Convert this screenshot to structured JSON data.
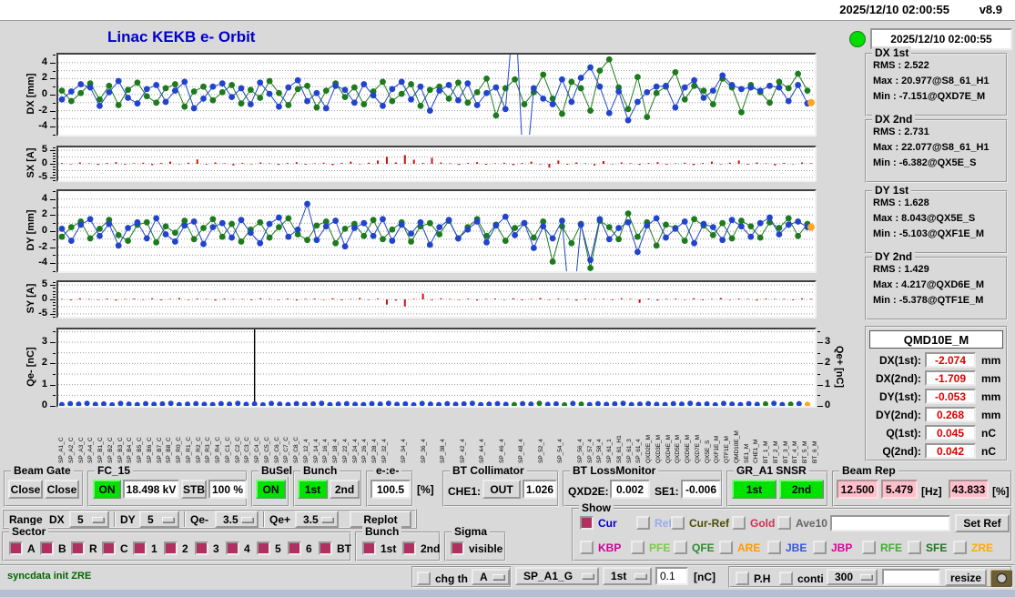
{
  "topbar": {
    "datetime": "2025/12/10 02:00:55",
    "version": "v8.9"
  },
  "title": "Linac KEKB e- Orbit",
  "status": {
    "datetime": "2025/12/10 02:00:55"
  },
  "stats_groups": [
    {
      "legend": "DX 1st",
      "lines": [
        "RMS :  2.522",
        "Max :  20.977@S8_61_H1",
        "Min :  -7.151@QXD7E_M"
      ]
    },
    {
      "legend": "DX 2nd",
      "lines": [
        "RMS :  2.731",
        "Max :  22.077@S8_61_H1",
        "Min :  -6.382@QX5E_S"
      ]
    },
    {
      "legend": "DY 1st",
      "lines": [
        "RMS :  1.628",
        "Max :  8.043@QX5E_S",
        "Min :  -5.103@QXF1E_M"
      ]
    },
    {
      "legend": "DY 2nd",
      "lines": [
        "RMS :  1.429",
        "Max :  4.217@QXD6E_M",
        "Min :  -5.378@QTF1E_M"
      ]
    }
  ],
  "qmd": {
    "title": "QMD10E_M",
    "rows": [
      {
        "label": "DX(1st):",
        "value": "-2.074",
        "unit": "mm"
      },
      {
        "label": "DX(2nd):",
        "value": "-1.709",
        "unit": "mm"
      },
      {
        "label": "DY(1st):",
        "value": "-0.053",
        "unit": "mm"
      },
      {
        "label": "DY(2nd):",
        "value": "0.268",
        "unit": "mm"
      },
      {
        "label": "Q(1st):",
        "value": "0.045",
        "unit": "nC"
      },
      {
        "label": "Q(2nd):",
        "value": "0.042",
        "unit": "nC"
      }
    ]
  },
  "axes": {
    "dx": {
      "label": "DX [mm]",
      "ticks": [
        4,
        2,
        0,
        -2,
        -4
      ],
      "ylim": [
        -5,
        5
      ],
      "minor": 1
    },
    "sx": {
      "label": "SX [A]",
      "ticks": [
        5,
        0,
        -5
      ],
      "ylim": [
        -6,
        6
      ],
      "minor": 1
    },
    "dy": {
      "label": "DY [mm]",
      "ticks": [
        4,
        2,
        0,
        -2,
        -4
      ],
      "ylim": [
        -5,
        5
      ],
      "minor": 1
    },
    "sy": {
      "label": "SY [A]",
      "ticks": [
        5,
        0,
        -5
      ],
      "ylim": [
        -6,
        6
      ],
      "minor": 1
    },
    "q": {
      "label_left": "Qe- [nC]",
      "label_right": "Qe+ [nC]",
      "ticks": [
        3,
        2,
        1,
        0
      ],
      "ylim": [
        0,
        3.6
      ],
      "minor": 0.5
    }
  },
  "chart_data": {
    "dx_orbit": {
      "type": "line",
      "title": "DX [mm]",
      "ylim": [
        -5,
        5
      ],
      "grid_step": 1,
      "series": [
        {
          "name": "DX 2nd",
          "color": "#1d7a1d",
          "values": [
            0.5,
            -0.8,
            0.2,
            1.4,
            -0.6,
            1.1,
            -1.3,
            0.6,
            1.5,
            -0.2,
            -1.0,
            0.8,
            1.3,
            -1.5,
            0.4,
            1.0,
            -0.7,
            0.3,
            1.2,
            -1.1,
            0.6,
            -0.4,
            1.7,
            0.2,
            -1.3,
            0.7,
            1.1,
            -1.6,
            0.5,
            1.4,
            -0.3,
            0.9,
            -1.2,
            0.4,
            1.6,
            -0.8,
            0.1,
            1.3,
            -1.4,
            0.6,
            1.0,
            -0.5,
            1.5,
            -1.0,
            0.3,
            2.0,
            -2.6,
            0.8,
            1.9,
            -1.2,
            0.3,
            2.5,
            -0.5,
            -2.4,
            1.6,
            0.8,
            -2.0,
            3.0,
            4.4,
            0.9,
            -1.8,
            2.2,
            -2.8,
            0.2,
            1.0,
            2.8,
            -0.6,
            1.1,
            0.5,
            -1.2,
            2.0,
            0.9,
            -2.2,
            1.2,
            0.3,
            -1.0,
            1.6,
            0.8,
            2.6,
            0.5
          ]
        },
        {
          "name": "DX 1st",
          "color": "#2244cc",
          "values": [
            -0.6,
            0.4,
            1.3,
            0.9,
            -1.4,
            0.3,
            1.7,
            -0.4,
            -1.1,
            0.7,
            1.2,
            -0.9,
            0.5,
            1.6,
            -1.7,
            -0.5,
            1.0,
            1.4,
            -0.3,
            0.8,
            -1.2,
            1.5,
            0.1,
            -1.5,
            0.9,
            1.8,
            -0.8,
            0.2,
            -1.7,
            1.1,
            0.6,
            -1.0,
            1.3,
            -0.1,
            -1.4,
            0.7,
            1.6,
            -0.6,
            1.0,
            -2.0,
            0.5,
            1.2,
            -0.7,
            1.4,
            -1.3,
            0.2,
            0.9,
            -1.8,
            12.0,
            -12.0,
            0.8,
            -0.5,
            -1.2,
            1.9,
            -0.9,
            2.1,
            3.4,
            1.0,
            -2.3,
            0.4,
            -3.2,
            -0.9,
            0.3,
            1.0,
            1.1,
            -1.6,
            0.9,
            1.8,
            -0.4,
            0.5,
            2.4,
            1.2,
            0.7,
            0.9,
            0.5,
            1.1,
            0.9,
            -0.8,
            1.2,
            -1.1
          ]
        }
      ],
      "extra_point": {
        "color": "#ffa520",
        "value": -1.0
      }
    },
    "sx_steering": {
      "type": "bar",
      "title": "SX [A]",
      "ylim": [
        -6,
        6
      ],
      "color": "#cc1111",
      "count": 84,
      "values_cycle": [
        0.3,
        -0.2,
        0.5,
        0.2,
        -0.4,
        0.3,
        0.6,
        -0.3,
        0.2,
        0.4,
        -0.5,
        0.3,
        0.8,
        -0.2,
        0.4,
        1.2,
        -0.3,
        0.5,
        0.2,
        -0.6
      ],
      "overrides": {
        "15": 1.6,
        "36": 2.6,
        "38": 3.2,
        "39": 1.5,
        "41": 2.2,
        "54": -1.4,
        "60": 1.0
      }
    },
    "dy_orbit": {
      "type": "line",
      "title": "DY [mm]",
      "ylim": [
        -5,
        5
      ],
      "grid_step": 1,
      "series": [
        {
          "name": "DY 2nd",
          "color": "#1d7a1d",
          "values": [
            -0.7,
            0.5,
            1.2,
            -0.9,
            0.3,
            1.4,
            -0.5,
            -1.2,
            0.8,
            1.1,
            -1.4,
            0.6,
            -0.2,
            1.3,
            -1.0,
            0.4,
            1.5,
            -0.7,
            0.9,
            -1.3,
            0.2,
            1.1,
            -0.8,
            0.5,
            1.6,
            -0.4,
            -1.1,
            0.7,
            1.2,
            -1.5,
            0.3,
            0.9,
            -0.6,
            1.4,
            -1.0,
            0.2,
            1.1,
            -1.3,
            0.6,
            1.0,
            -0.4,
            1.3,
            -0.9,
            0.5,
            1.5,
            -0.6,
            0.8,
            -1.2,
            0.4,
            1.0,
            -0.8,
            1.2,
            -3.8,
            0.6,
            -1.5,
            0.9,
            -4.6,
            1.3,
            0.5,
            -1.0,
            2.2,
            -0.7,
            1.1,
            -1.8,
            0.8,
            0.4,
            -1.2,
            1.5,
            0.7,
            -0.5,
            1.0,
            -0.9,
            1.3,
            0.6,
            -0.8,
            1.1,
            0.4,
            1.6,
            -0.6,
            0.9
          ]
        },
        {
          "name": "DY 1st",
          "color": "#2244cc",
          "values": [
            0.3,
            -1.2,
            0.8,
            1.5,
            -0.6,
            0.9,
            -1.8,
            0.4,
            1.1,
            -0.9,
            1.6,
            -0.4,
            -1.3,
            0.7,
            1.2,
            -1.6,
            0.5,
            1.0,
            -0.8,
            1.4,
            -0.2,
            -1.5,
            0.9,
            1.7,
            -0.7,
            0.2,
            3.4,
            -1.1,
            0.6,
            1.3,
            -1.9,
            0.4,
            1.0,
            -0.6,
            1.5,
            -1.2,
            0.8,
            -0.3,
            1.1,
            -1.7,
            0.5,
            1.4,
            -0.9,
            0.2,
            1.2,
            -1.4,
            0.7,
            1.8,
            -0.5,
            1.0,
            -2.1,
            0.6,
            -0.9,
            1.3,
            -12.0,
            0.8,
            -3.6,
            1.5,
            -1.0,
            0.4,
            1.1,
            -2.6,
            0.7,
            1.6,
            -0.8,
            0.3,
            1.2,
            -1.5,
            0.9,
            0.5,
            -1.1,
            1.4,
            0.6,
            -0.7,
            1.0,
            1.7,
            -0.4,
            0.8,
            1.2,
            0.5
          ]
        }
      ],
      "extra_point": {
        "color": "#ffa520",
        "value": 0.5
      }
    },
    "sy_steering": {
      "type": "bar",
      "title": "SY [A]",
      "ylim": [
        -6,
        6
      ],
      "color": "#cc1111",
      "count": 84,
      "values_cycle": [
        0.2,
        -0.3,
        0.4,
        0.2,
        -0.2,
        0.3,
        -0.4,
        0.2,
        0.3,
        -0.2,
        0.4,
        -0.3,
        0.2,
        0.5,
        -0.2,
        0.3,
        0.2,
        -0.4,
        0.3,
        0.2
      ],
      "overrides": {
        "36": -1.8,
        "38": -2.4,
        "40": 2.0,
        "64": -1.2
      }
    },
    "charge": {
      "type": "scatter",
      "title": "Qe- [nC]",
      "right_axis": "Qe+ [nC]",
      "ylim": [
        0,
        3.6
      ],
      "dot_color": "#2244cc",
      "green_color": "#1d7a1d",
      "last_color": "#ffa520",
      "count": 90,
      "values_cycle": [
        0.06,
        0.1,
        0.08,
        0.12,
        0.07,
        0.09,
        0.05,
        0.11,
        0.08,
        0.06,
        0.1,
        0.07,
        0.09,
        0.12,
        0.06,
        0.08,
        0.1,
        0.07
      ],
      "spike_index": 23,
      "green_indices": [
        54,
        57,
        60,
        62,
        84,
        87
      ]
    }
  },
  "xaxis_labels": [
    "SP_A1_C",
    "SP_A2_C",
    "SP_A3_C",
    "SP_A4_C",
    "SP_B1_C",
    "SP_B2_C",
    "SP_B3_C",
    "SP_B4_C",
    "SP_B5_C",
    "SP_B6_C",
    "SP_B7_C",
    "SP_B8_C",
    "SP_R0_C",
    "SP_R1_C",
    "SP_R2_C",
    "SP_R3_C",
    "SP_R4_C",
    "SP_C1_C",
    "SP_C2_C",
    "SP_C3_C",
    "SP_C4_C",
    "SP_C5_C",
    "SP_C6_C",
    "SP_C7_C",
    "SP_C8_C",
    "SP_12_4",
    "SP_14_4",
    "SP_16_4",
    "SP_18_4",
    "SP_22_4",
    "SP_24_4",
    "SP_26_4",
    "SP_28_4",
    "SP_32_4",
    "",
    "SP_34_4",
    "",
    "SP_36_4",
    "",
    "SP_38_4",
    "",
    "SP_42_4",
    "",
    "SP_44_4",
    "",
    "SP_46_4",
    "",
    "SP_48_4",
    "",
    "SP_52_4",
    "",
    "SP_54_4",
    "",
    "SP_56_4",
    "SP_57_4",
    "SP_58_4",
    "SP_61_1",
    "S8_61_H1",
    "SP_61_3",
    "SP_61_4",
    "QXD2E_M",
    "QXD3E_M",
    "QXD4E_M",
    "QXD5E_M",
    "QXD6E_M",
    "QXD7E_M",
    "QX5E_S",
    "QXF1E_M",
    "QTF1E_M",
    "QMD10E_M",
    "SE1_M",
    "CHE1_M",
    "BT_1_M",
    "BT_2_M",
    "BT_3_M",
    "BT_4_M",
    "BT_5_M",
    "BT_6_M"
  ],
  "beam_gate": {
    "legend": "Beam Gate",
    "btn1": "Close",
    "btn2": "Close"
  },
  "fc15": {
    "legend": "FC_15",
    "on": "ON",
    "kv": "18.498 kV",
    "stb": "STB",
    "pct": "100 %"
  },
  "busel": {
    "legend": "BuSel",
    "on": "ON"
  },
  "bunch": {
    "legend": "Bunch",
    "first": "1st",
    "second": "2nd"
  },
  "ee": {
    "legend": "e-:e-",
    "value": "100.5",
    "unit": "[%]"
  },
  "bt_col": {
    "legend": "BT Collimator",
    "che1_label": "CHE1:",
    "che1_state": "OUT",
    "value": "1.026"
  },
  "bt_loss": {
    "legend": "BT LossMonitor",
    "qxd2e_label": "QXD2E:",
    "qxd2e": "0.002",
    "se1_label": "SE1:",
    "se1": "-0.006"
  },
  "gr_snsr": {
    "legend": "GR_A1 SNSR",
    "first": "1st",
    "second": "2nd"
  },
  "beam_rep": {
    "legend": "Beam Rep",
    "v1": "12.500",
    "v2": "5.479",
    "hz": "[Hz]",
    "v3": "43.833",
    "pct": "[%]"
  },
  "range": {
    "label": "Range",
    "dx_label": "DX",
    "dx": "5",
    "dy_label": "DY",
    "dy": "5",
    "qem_label": "Qe-",
    "qem": "3.5",
    "qep_label": "Qe+",
    "qep": "3.5",
    "replot": "Replot"
  },
  "sector": {
    "legend": "Sector",
    "items": [
      {
        "label": "A",
        "checked": true
      },
      {
        "label": "B",
        "checked": true
      },
      {
        "label": "R",
        "checked": true
      },
      {
        "label": "C",
        "checked": true
      },
      {
        "label": "1",
        "checked": true
      },
      {
        "label": "2",
        "checked": true
      },
      {
        "label": "3",
        "checked": true
      },
      {
        "label": "4",
        "checked": true
      },
      {
        "label": "5",
        "checked": true
      },
      {
        "label": "6",
        "checked": true
      },
      {
        "label": "BT",
        "checked": true
      }
    ]
  },
  "bunch2": {
    "legend": "Bunch",
    "items": [
      {
        "label": "1st",
        "checked": true
      },
      {
        "label": "2nd",
        "checked": true
      }
    ]
  },
  "sigma": {
    "legend": "Sigma",
    "items": [
      {
        "label": "visible",
        "checked": true
      }
    ]
  },
  "show": {
    "legend": "Show",
    "row1": [
      {
        "label": "Cur",
        "color": "#0000cc",
        "checked": true
      },
      {
        "label": "Ref",
        "color": "#99aaee",
        "checked": false
      },
      {
        "label": "Cur-Ref",
        "color": "#4c4c00",
        "checked": false
      },
      {
        "label": "Gold",
        "color": "#cc3355",
        "checked": false
      },
      {
        "label": "Ave10",
        "color": "#666666",
        "checked": false
      }
    ],
    "ref_input": "",
    "set_ref": "Set Ref",
    "row2": [
      {
        "label": "KBP",
        "color": "#cc0099",
        "checked": false
      },
      {
        "label": "PFE",
        "color": "#77cc44",
        "checked": false
      },
      {
        "label": "QFE",
        "color": "#2e8b2e",
        "checked": false
      },
      {
        "label": "ARE",
        "color": "#ff9900",
        "checked": false
      },
      {
        "label": "JBE",
        "color": "#3355dd",
        "checked": false
      },
      {
        "label": "JBP",
        "color": "#dd0099",
        "checked": false
      },
      {
        "label": "RFE",
        "color": "#44aa33",
        "checked": false
      },
      {
        "label": "SFE",
        "color": "#207520",
        "checked": false
      },
      {
        "label": "ZRE",
        "color": "#ffaa00",
        "checked": false
      }
    ]
  },
  "statusbar": {
    "message": "syncdata init ZRE",
    "chg_th": "chg th",
    "chg_sel": "A",
    "sp_sel": "SP_A1_G",
    "bunch_sel": "1st",
    "th_value": "0.1",
    "th_unit": "[nC]",
    "ph": "P.H",
    "conti": "conti",
    "points": "300",
    "extra_input": "",
    "resize": "resize"
  }
}
